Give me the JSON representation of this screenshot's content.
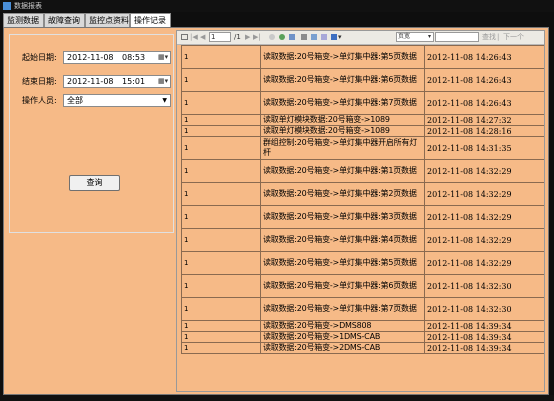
{
  "window": {
    "title": "数据报表"
  },
  "tabs": [
    {
      "label": "监测数据",
      "active": false
    },
    {
      "label": "故障查询",
      "active": false
    },
    {
      "label": "监控点资料",
      "active": false
    },
    {
      "label": "操作记录",
      "active": true
    }
  ],
  "filter": {
    "start_label": "起始日期:",
    "start_date": "2012-11-08",
    "start_time": "08:53",
    "end_label": "结束日期:",
    "end_date": "2012-11-08",
    "end_time": "15:01",
    "operator_label": "操作人员:",
    "operator_value": "全部",
    "query_button": "查询"
  },
  "toolbar": {
    "page_current": "1",
    "page_total": "/1",
    "zoom_value": "页宽",
    "find_label": "查找",
    "next_label": "下一个",
    "separator": "|"
  },
  "records": [
    {
      "col1": "1",
      "col2": "读取数据:20号箱变->单灯集中器:第5页数据",
      "col3": "2012-11-08 14:26:43"
    },
    {
      "col1": "1",
      "col2": "读取数据:20号箱变->单灯集中器:第6页数据",
      "col3": "2012-11-08 14:26:43"
    },
    {
      "col1": "1",
      "col2": "读取数据:20号箱变->单灯集中器:第7页数据",
      "col3": "2012-11-08 14:26:43"
    },
    {
      "col1": "1",
      "col2": "读取单灯模块数据:20号箱变->1089",
      "col3": "2012-11-08 14:27:32"
    },
    {
      "col1": "1",
      "col2": "读取单灯模块数据:20号箱变->1089",
      "col3": "2012-11-08 14:28:16"
    },
    {
      "col1": "1",
      "col2": "群组控制:20号箱变->单灯集中器开启所有灯杆",
      "col3": "2012-11-08 14:31:35"
    },
    {
      "col1": "1",
      "col2": "读取数据:20号箱变->单灯集中器:第1页数据",
      "col3": "2012-11-08 14:32:29"
    },
    {
      "col1": "1",
      "col2": "读取数据:20号箱变->单灯集中器:第2页数据",
      "col3": "2012-11-08 14:32:29"
    },
    {
      "col1": "1",
      "col2": "读取数据:20号箱变->单灯集中器:第3页数据",
      "col3": "2012-11-08 14:32:29"
    },
    {
      "col1": "1",
      "col2": "读取数据:20号箱变->单灯集中器:第4页数据",
      "col3": "2012-11-08 14:32:29"
    },
    {
      "col1": "1",
      "col2": "读取数据:20号箱变->单灯集中器:第5页数据",
      "col3": "2012-11-08 14:32:29"
    },
    {
      "col1": "1",
      "col2": "读取数据:20号箱变->单灯集中器:第6页数据",
      "col3": "2012-11-08 14:32:30"
    },
    {
      "col1": "1",
      "col2": "读取数据:20号箱变->单灯集中器:第7页数据",
      "col3": "2012-11-08 14:32:30"
    },
    {
      "col1": "1",
      "col2": "读取数据:20号箱变->DMS808",
      "col3": "2012-11-08 14:39:34"
    },
    {
      "col1": "1",
      "col2": "读取数据:20号箱变->1DMS-CAB",
      "col3": "2012-11-08 14:39:34"
    },
    {
      "col1": "1",
      "col2": "读取数据:20号箱变->2DMS-CAB",
      "col3": "2012-11-08 14:39:34"
    }
  ]
}
